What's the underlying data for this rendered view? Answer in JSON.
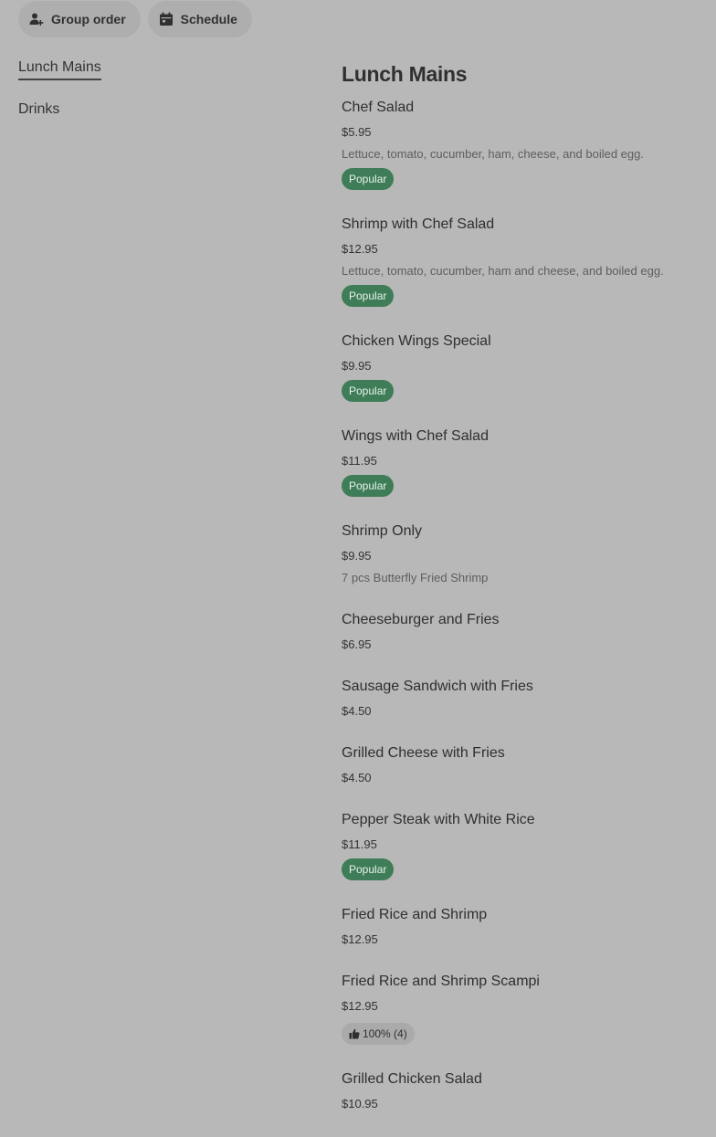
{
  "top_actions": {
    "group_order_label": "Group order",
    "schedule_label": "Schedule"
  },
  "sidebar": {
    "items": [
      {
        "label": "Lunch Mains",
        "active": true
      },
      {
        "label": "Drinks",
        "active": false
      }
    ]
  },
  "section": {
    "title": "Lunch Mains"
  },
  "badge_label": "Popular",
  "colors": {
    "page_background": "#b8b8b8",
    "pill_background": "#aeaeae",
    "popular_badge": "#3e7d57"
  },
  "menu_items": [
    {
      "name": "Chef Salad",
      "price": "$5.95",
      "description": "Lettuce, tomato, cucumber, ham, cheese, and boiled egg.",
      "badge": "Popular"
    },
    {
      "name": "Shrimp with Chef Salad",
      "price": "$12.95",
      "description": "Lettuce, tomato, cucumber, ham and cheese, and boiled egg.",
      "badge": "Popular"
    },
    {
      "name": "Chicken Wings Special",
      "price": "$9.95",
      "badge": "Popular"
    },
    {
      "name": "Wings with Chef Salad",
      "price": "$11.95",
      "badge": "Popular"
    },
    {
      "name": "Shrimp Only",
      "price": "$9.95",
      "description": "7 pcs Butterfly Fried Shrimp"
    },
    {
      "name": "Cheeseburger and Fries",
      "price": "$6.95"
    },
    {
      "name": "Sausage Sandwich with Fries",
      "price": "$4.50"
    },
    {
      "name": "Grilled Cheese with Fries",
      "price": "$4.50"
    },
    {
      "name": "Pepper Steak with White Rice",
      "price": "$11.95",
      "badge": "Popular"
    },
    {
      "name": "Fried Rice and Shrimp",
      "price": "$12.95"
    },
    {
      "name": "Fried Rice and Shrimp Scampi",
      "price": "$12.95",
      "rating": "100% (4)"
    },
    {
      "name": "Grilled Chicken Salad",
      "price": "$10.95"
    }
  ]
}
